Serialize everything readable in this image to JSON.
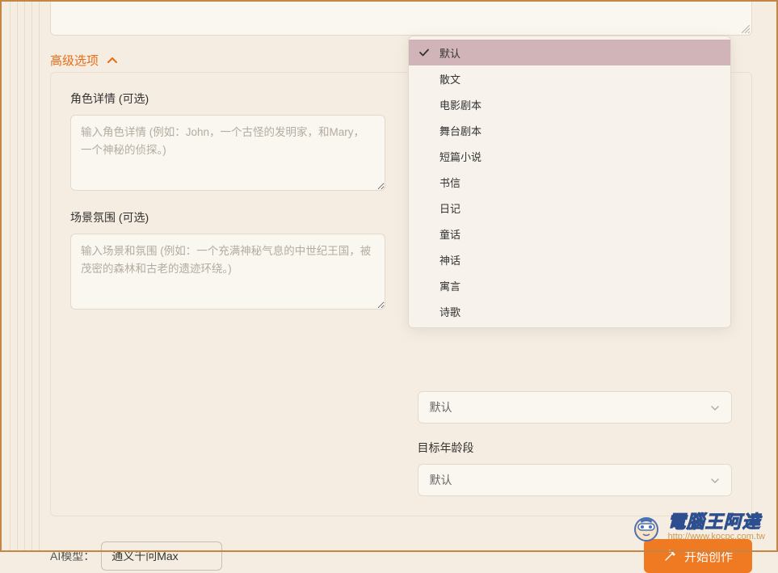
{
  "advanced_toggle_label": "高级选项",
  "character": {
    "label": "角色详情 (可选)",
    "placeholder": "输入角色详情 (例如：John，一个古怪的发明家，和Mary，一个神秘的侦探。)"
  },
  "setting": {
    "label": "场景氛围 (可选)",
    "placeholder": "输入场景和氛围 (例如：一个充满神秘气息的中世纪王国，被茂密的森林和古老的遗迹环绕。)"
  },
  "dropdown": {
    "items": [
      "默认",
      "散文",
      "电影剧本",
      "舞台剧本",
      "短篇小说",
      "书信",
      "日记",
      "童话",
      "神话",
      "寓言",
      "诗歌"
    ],
    "selected": "默认"
  },
  "genre_select_value": "默认",
  "age_label": "目标年龄段",
  "age_select_value": "默认",
  "model_label": "AI模型：",
  "model_value": "通义千问Max",
  "start_label": "开始创作",
  "watermark": {
    "title": "電腦王阿達",
    "url": "http://www.kocpc.com.tw"
  }
}
